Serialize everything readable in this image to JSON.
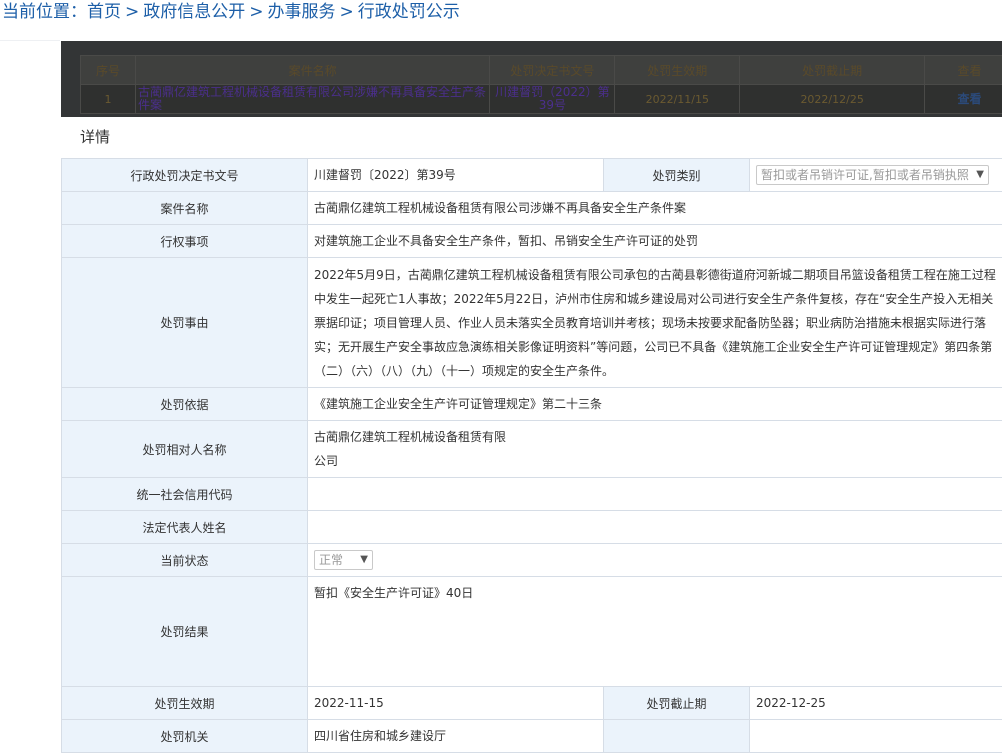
{
  "breadcrumb": {
    "label": "当前位置：",
    "items": [
      "首页",
      "政府信息公开",
      "办事服务",
      "行政处罚公示"
    ],
    "sep": ">"
  },
  "list": {
    "headers": [
      "序号",
      "案件名称",
      "处罚决定书文号",
      "处罚生效期",
      "处罚截止期",
      "查看"
    ],
    "row": {
      "index": "1",
      "name": "古蔺鼎亿建筑工程机械设备租赁有限公司涉嫌不再具备安全生产条件案",
      "doc": "川建督罚（2022）第39号",
      "start": "2022/11/15",
      "end": "2022/12/25",
      "view": "查看"
    }
  },
  "detail": {
    "title": "详情",
    "doc_no_label": "行政处罚决定书文号",
    "doc_no": "川建督罚〔2022〕第39号",
    "category_label": "处罚类别",
    "category": "暂扣或者吊销许可证,暂扣或者吊销执照",
    "case_name_label": "案件名称",
    "case_name": "古蔺鼎亿建筑工程机械设备租赁有限公司涉嫌不再具备安全生产条件案",
    "power_label": "行权事项",
    "power": "对建筑施工企业不具备安全生产条件，暂扣、吊销安全生产许可证的处罚",
    "reason_label": "处罚事由",
    "reason": "2022年5月9日，古蔺鼎亿建筑工程机械设备租赁有限公司承包的古蔺县彰德街道府河新城二期项目吊篮设备租赁工程在施工过程中发生一起死亡1人事故；2022年5月22日，泸州市住房和城乡建设局对公司进行安全生产条件复核，存在“安全生产投入无相关票据印证；项目管理人员、作业人员未落实全员教育培训并考核；现场未按要求配备防坠器；职业病防治措施未根据实际进行落实；无开展生产安全事故应急演练相关影像证明资料”等问题，公司已不具备《建筑施工企业安全生产许可证管理规定》第四条第（二）（六）（八）（九）（十一）项规定的安全生产条件。",
    "basis_label": "处罚依据",
    "basis": "《建筑施工企业安全生产许可证管理规定》第二十三条",
    "party_label": "处罚相对人名称",
    "party_line1": "古蔺鼎亿建筑工程机械设备租赁有限",
    "party_line2": "公司",
    "credit_label": "统一社会信用代码",
    "credit": "",
    "legal_rep_label": "法定代表人姓名",
    "legal_rep": "",
    "status_label": "当前状态",
    "status": "正常",
    "result_label": "处罚结果",
    "result": "暂扣《安全生产许可证》40日",
    "start_label": "处罚生效期",
    "start": "2022-11-15",
    "end_label": "处罚截止期",
    "end": "2022-12-25",
    "authority_label": "处罚机关",
    "authority": "四川省住房和城乡建设厅"
  }
}
